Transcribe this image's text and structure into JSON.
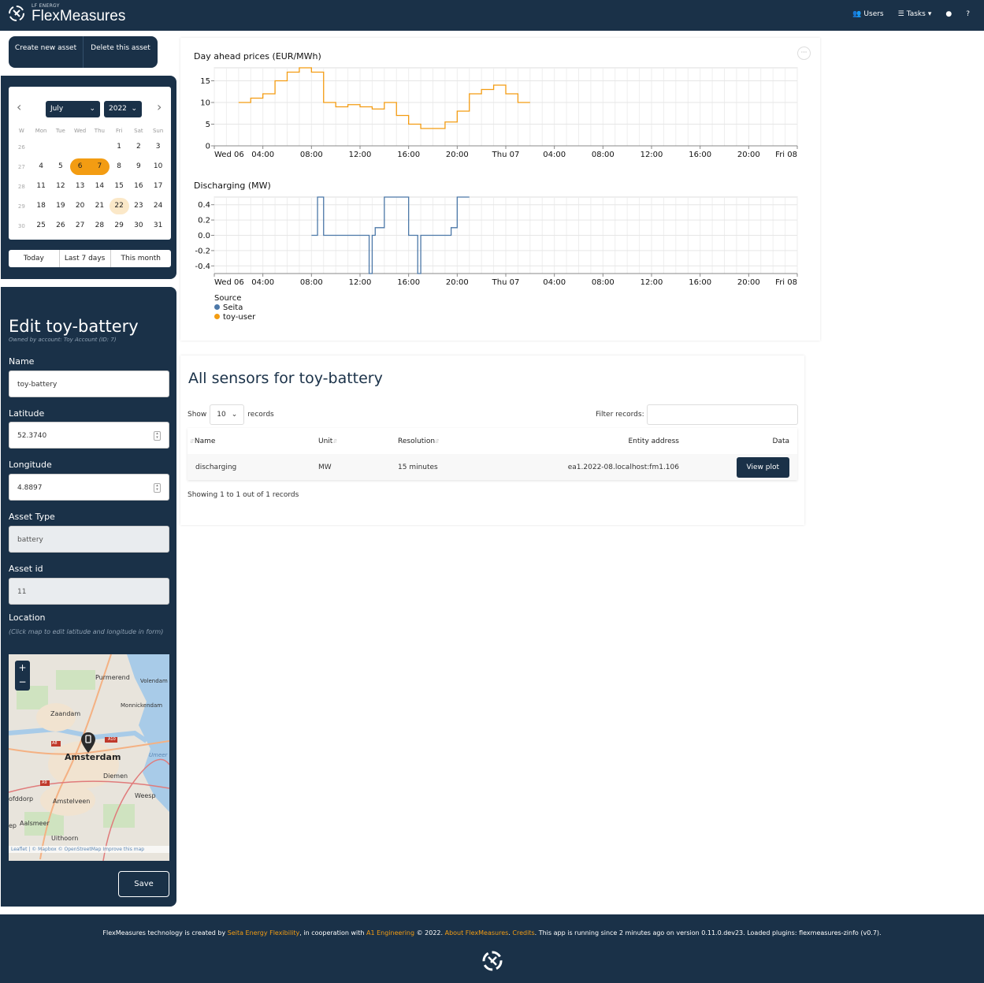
{
  "navbar": {
    "brand_sub": "LF ENERGY",
    "brand_name": "FlexMeasures",
    "users_label": "Users",
    "tasks_label": "Tasks",
    "user_icon": "user-icon",
    "help_label": "?"
  },
  "asset_buttons": {
    "create_label": "Create new asset",
    "delete_label": "Delete this asset"
  },
  "calendar": {
    "month": "July",
    "year": "2022",
    "weekday_headers": [
      "W",
      "Mon",
      "Tue",
      "Wed",
      "Thu",
      "Fri",
      "Sat",
      "Sun"
    ],
    "weeks": [
      {
        "week": "26",
        "days": [
          "",
          "",
          "",
          "",
          "1",
          "2",
          "3"
        ]
      },
      {
        "week": "27",
        "days": [
          "4",
          "5",
          "6",
          "7",
          "8",
          "9",
          "10"
        ]
      },
      {
        "week": "28",
        "days": [
          "11",
          "12",
          "13",
          "14",
          "15",
          "16",
          "17"
        ]
      },
      {
        "week": "29",
        "days": [
          "18",
          "19",
          "20",
          "21",
          "22",
          "23",
          "24"
        ]
      },
      {
        "week": "30",
        "days": [
          "25",
          "26",
          "27",
          "28",
          "29",
          "30",
          "31"
        ]
      }
    ],
    "selected_days": [
      "6",
      "7"
    ],
    "today": "22",
    "ranges": [
      "Today",
      "Last 7 days",
      "This month"
    ]
  },
  "edit_form": {
    "title": "Edit toy-battery",
    "owner": "Owned by account: Toy Account (ID: 7)",
    "name_label": "Name",
    "name_value": "toy-battery",
    "latitude_label": "Latitude",
    "latitude_value": "52.3740",
    "longitude_label": "Longitude",
    "longitude_value": "4.8897",
    "asset_type_label": "Asset Type",
    "asset_type_value": "battery",
    "asset_id_label": "Asset id",
    "asset_id_value": "11",
    "location_label": "Location",
    "location_hint": "(Click map to edit latitude and longitude in form)",
    "save_label": "Save"
  },
  "map": {
    "places": [
      "Purmerend",
      "Volendam",
      "Monnickendam",
      "Zaandam",
      "Amsterdam",
      "Diemen",
      "Weesp",
      "Amstelveen",
      "Aalsmeer",
      "Uithoorn",
      "Umeer",
      "ofddorp",
      "ep"
    ],
    "road_labels": [
      "A8",
      "A10",
      "A9"
    ],
    "attribution": "Leaflet | © Mapbox © OpenStreetMap Improve this map",
    "zoom_in": "+",
    "zoom_out": "−"
  },
  "chart_data": [
    {
      "type": "line",
      "title": "Day ahead prices (EUR/MWh)",
      "interpolation": "step",
      "x_ticks": [
        "Wed 06",
        "04:00",
        "08:00",
        "12:00",
        "16:00",
        "20:00",
        "Thu 07",
        "04:00",
        "08:00",
        "12:00",
        "16:00",
        "20:00",
        "Fri 08"
      ],
      "ylim": [
        0,
        18
      ],
      "y_ticks": [
        "0",
        "5",
        "10",
        "15"
      ],
      "grid": true,
      "series": [
        {
          "name": "toy-user",
          "color": "#f39c12",
          "x_hours": [
            2,
            3,
            4,
            5,
            6,
            7,
            8,
            9,
            10,
            11,
            12,
            13,
            14,
            15,
            16,
            17,
            18,
            19,
            20,
            21,
            22,
            23,
            24,
            25
          ],
          "values": [
            10,
            11,
            12,
            15,
            17,
            18,
            17,
            10,
            9,
            9.5,
            9,
            8.5,
            10,
            7,
            5,
            4,
            4,
            5.5,
            8,
            12,
            13,
            14,
            12,
            10
          ]
        }
      ]
    },
    {
      "type": "line",
      "title": "Discharging (MW)",
      "interpolation": "step",
      "x_ticks": [
        "Wed 06",
        "04:00",
        "08:00",
        "12:00",
        "16:00",
        "20:00",
        "Thu 07",
        "04:00",
        "08:00",
        "12:00",
        "16:00",
        "20:00",
        "Fri 08"
      ],
      "ylim": [
        -0.5,
        0.5
      ],
      "y_ticks": [
        "-0.4",
        "-0.2",
        "0.0",
        "0.2",
        "0.4"
      ],
      "grid": true,
      "series": [
        {
          "name": "Seita",
          "color": "#4c78a8",
          "x_hours": [
            8,
            8.5,
            9,
            12,
            12.75,
            13,
            13.25,
            14,
            16,
            16.75,
            17,
            19,
            19.5,
            20
          ],
          "values": [
            0,
            0.5,
            0,
            0,
            -0.5,
            0,
            0.1,
            0.5,
            0,
            -0.5,
            0,
            0,
            0.1,
            0.5
          ]
        }
      ],
      "legend_title": "Source",
      "legend": [
        {
          "name": "Seita",
          "color": "#4c78a8"
        },
        {
          "name": "toy-user",
          "color": "#f39c12"
        }
      ]
    }
  ],
  "sensors": {
    "title": "All sensors for toy-battery",
    "show_label": "Show",
    "page_size": "10",
    "records_label": "records",
    "filter_label": "Filter records:",
    "columns": [
      "Name",
      "Unit",
      "Resolution",
      "Entity address",
      "Data"
    ],
    "rows": [
      {
        "name": "discharging",
        "unit": "MW",
        "resolution": "15 minutes",
        "entity_address": "ea1.2022-08.localhost:fm1.106",
        "action": "View plot"
      }
    ],
    "showing_text": "Showing 1 to 1 out of 1 records"
  },
  "footer": {
    "t1": "FlexMeasures technology is created by ",
    "l1": "Seita Energy Flexibility",
    "t2": ", in cooperation with ",
    "l2": "A1 Engineering",
    "t3": " © 2022. ",
    "l3": "About FlexMeasures",
    "t4": ". ",
    "l4": "Credits",
    "t5": ". This app is running since 2 minutes ago on version 0.11.0.dev23. Loaded plugins: flexmeasures-zinfo (v0.7)."
  },
  "colors": {
    "primary": "#1a3148",
    "accent": "#f39c12",
    "series_blue": "#4c78a8"
  }
}
